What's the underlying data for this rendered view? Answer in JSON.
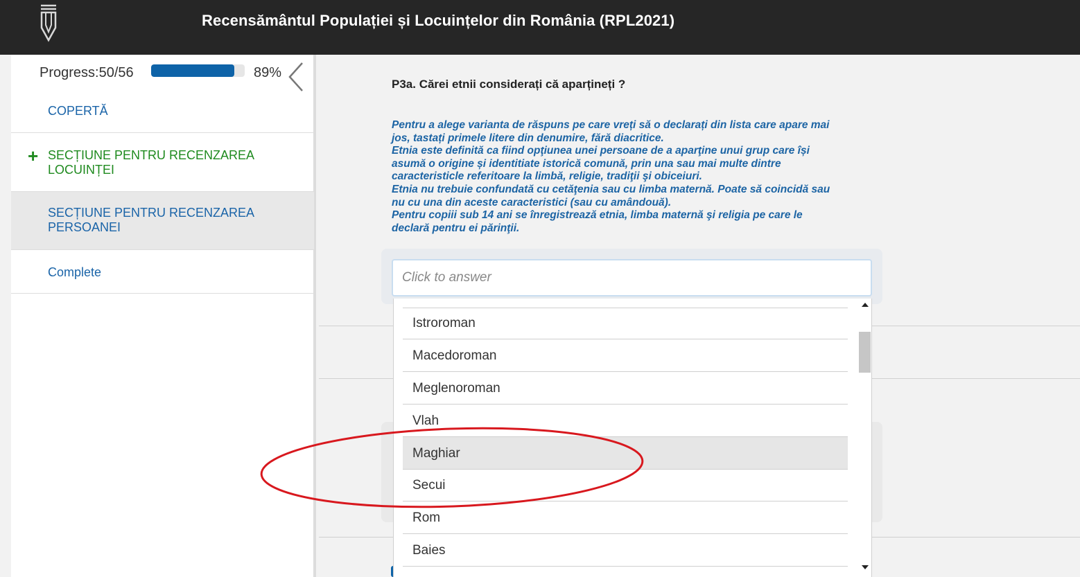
{
  "header": {
    "title": "Recensământul Populației și Locuințelor din România (RPL2021)",
    "logo_icon": "pen-nib-logo-icon"
  },
  "sidebar": {
    "progress": {
      "label": "Progress:50/56",
      "percent_label": "89%",
      "fraction": 0.89
    },
    "items": [
      {
        "label": "COPERTĂ"
      },
      {
        "label": "SECȚIUNE PENTRU RECENZAREA LOCUINȚEI",
        "icon": "plus-icon"
      },
      {
        "label": "SECȚIUNE PENTRU RECENZAREA PERSOANEI"
      },
      {
        "label": "Complete"
      }
    ]
  },
  "question": {
    "title": "P3a. Cărei etnii considerați că aparțineți ?",
    "instructions": [
      "Pentru a alege varianta de răspuns pe care vreți să o declarați din lista care apare mai jos, tastați primele litere din denumire, fără diacritice.",
      "Etnia este definită ca fiind opţiunea unei persoane de a aparţine unui grup care își asumă o origine și identitiate istorică comună, prin una sau mai multe dintre caracteristicle referitoare la limbă, religie, tradiţii şi obiceiuri.",
      "Etnia nu trebuie confundată cu cetăţenia sau cu limba maternă. Poate să coincidă sau nu cu una din aceste caracteristici (sau cu amândouă).",
      "Pentru copiii sub 14 ani se înregistrează etnia, limba maternă şi religia pe care le declară pentru ei părinţii."
    ],
    "input": {
      "placeholder": "Click to answer",
      "value": ""
    }
  },
  "dropdown": {
    "options": [
      "Istroroman",
      "Macedoroman",
      "Meglenoroman",
      "Vlah",
      "Maghiar",
      "Secui",
      "Rom",
      "Baies"
    ],
    "highlighted": "Maghiar"
  },
  "colors": {
    "header_bg": "#262626",
    "accent_blue": "#0e63a8",
    "link_blue": "#1a64a8",
    "section_green": "#1f8a1f",
    "annotation_red": "#d8181e"
  }
}
